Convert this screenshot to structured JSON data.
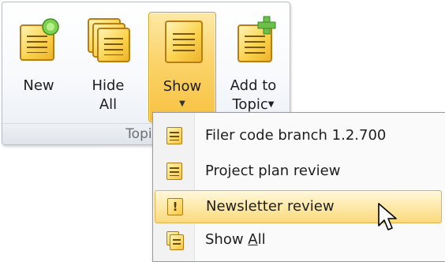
{
  "ribbon": {
    "group_label": "Topics",
    "buttons": [
      {
        "label": "New",
        "icon": "note-new-icon"
      },
      {
        "label": "Hide All",
        "icon": "notes-stack-icon"
      },
      {
        "label": "Show",
        "icon": "note-icon",
        "has_dropdown": true
      },
      {
        "label": "Add to Topic",
        "icon": "note-add-icon",
        "has_dropdown": true
      }
    ],
    "show_label": "Show",
    "new_label": "New",
    "hide_line1": "Hide",
    "hide_line2": "All",
    "add_line1": "Add to",
    "add_line2": "Topic",
    "dropdown_arrow": "▼"
  },
  "menu": {
    "items": [
      {
        "label": "Filer code branch 1.2.700",
        "icon": "note-icon"
      },
      {
        "label": "Project plan review",
        "icon": "note-icon"
      },
      {
        "label": "Newsletter review",
        "icon": "note-exclamation-icon",
        "highlighted": true
      },
      {
        "label_prefix": "Show ",
        "label_accel": "A",
        "label_suffix": "ll",
        "icon": "notes-stack-icon"
      }
    ]
  },
  "colors": {
    "accent_highlight": "#fbd97c",
    "note_yellow": "#fbd34f",
    "note_border": "#b97d12",
    "plus_green": "#6cc04a"
  }
}
